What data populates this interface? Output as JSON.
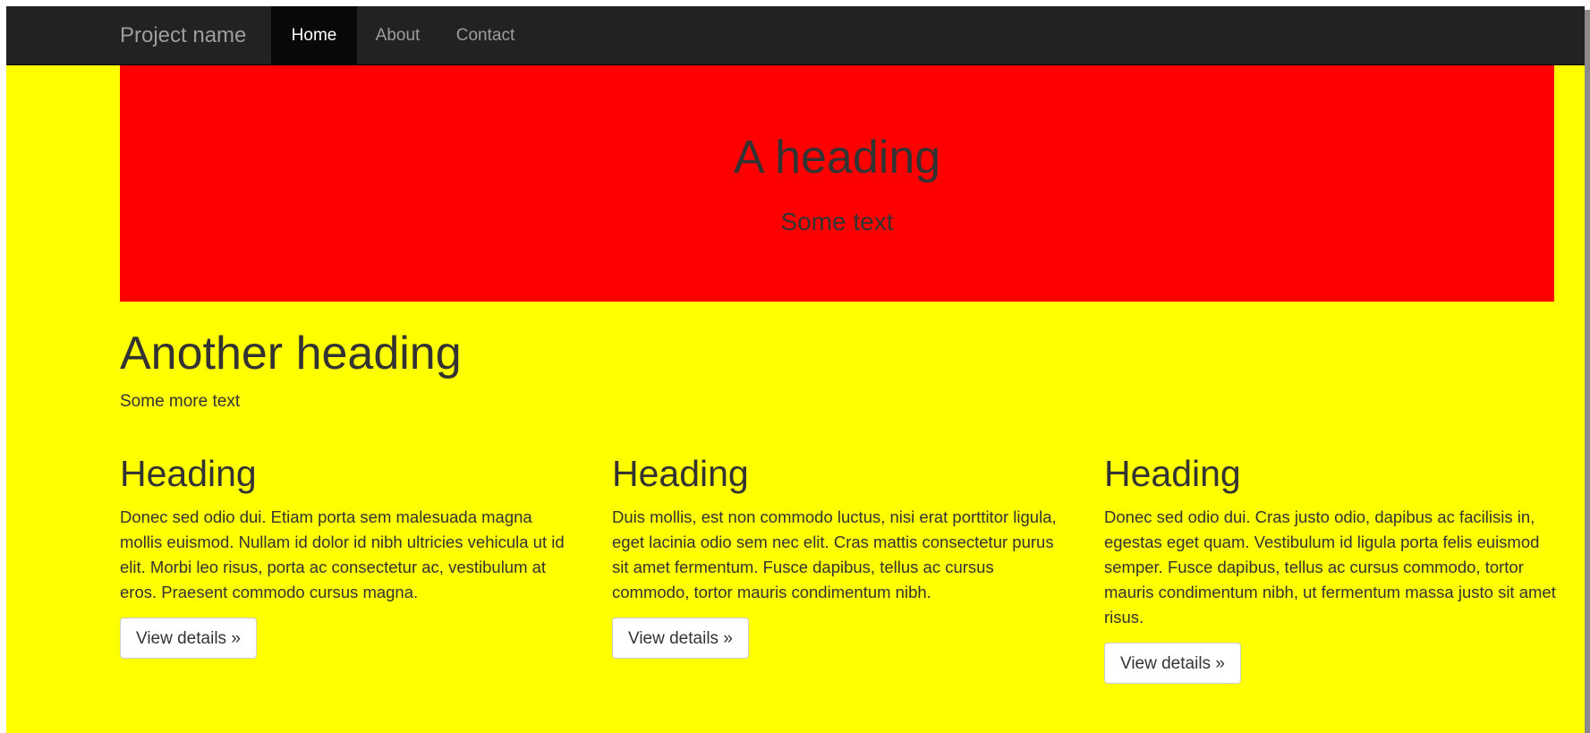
{
  "navbar": {
    "brand": "Project name",
    "links": [
      {
        "label": "Home",
        "active": true
      },
      {
        "label": "About",
        "active": false
      },
      {
        "label": "Contact",
        "active": false
      }
    ]
  },
  "jumbotron": {
    "heading": "A heading",
    "text": "Some text"
  },
  "intro": {
    "heading": "Another heading",
    "text": "Some more text"
  },
  "columns": [
    {
      "heading": "Heading",
      "text": "Donec sed odio dui. Etiam porta sem malesuada magna mollis euismod. Nullam id dolor id nibh ultricies vehicula ut id elit. Morbi leo risus, porta ac consectetur ac, vestibulum at eros. Praesent commodo cursus magna.",
      "button": "View details »"
    },
    {
      "heading": "Heading",
      "text": "Duis mollis, est non commodo luctus, nisi erat porttitor ligula, eget lacinia odio sem nec elit. Cras mattis consectetur purus sit amet fermentum. Fusce dapibus, tellus ac cursus commodo, tortor mauris condimentum nibh.",
      "button": "View details »"
    },
    {
      "heading": "Heading",
      "text": "Donec sed odio dui. Cras justo odio, dapibus ac facilisis in, egestas eget quam. Vestibulum id ligula porta felis euismod semper. Fusce dapibus, tellus ac cursus commodo, tortor mauris condimentum nibh, ut fermentum massa justo sit amet risus.",
      "button": "View details »"
    }
  ],
  "colors": {
    "page_background": "#ffff00",
    "jumbotron_background": "#ff0000",
    "navbar_background": "#222222",
    "active_nav_background": "#080808"
  }
}
